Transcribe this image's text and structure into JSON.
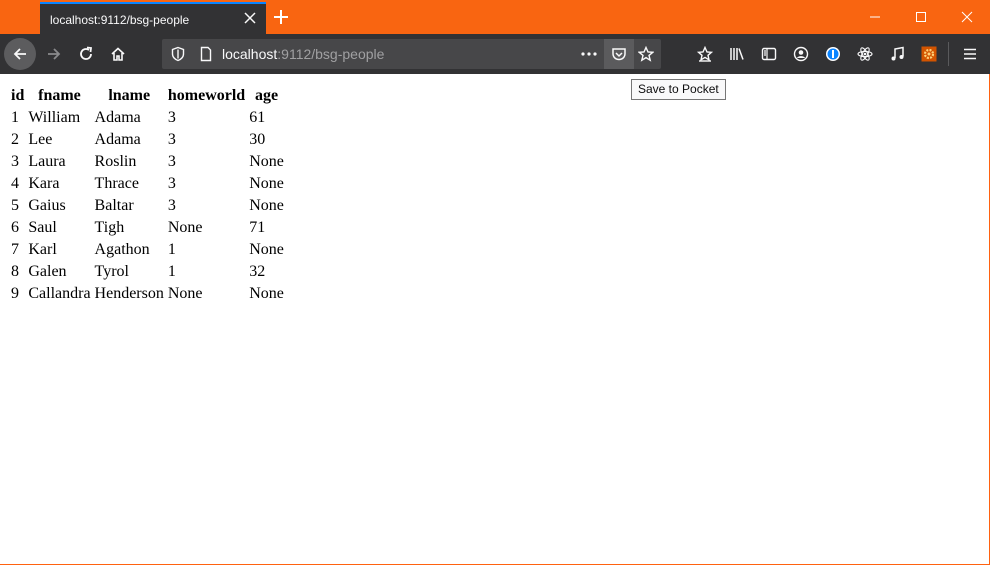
{
  "browser": {
    "tab_title": "localhost:9112/bsg-people",
    "url_host": "localhost",
    "url_path": ":9112/bsg-people",
    "tooltip": "Save to Pocket",
    "accent_color": "#0a84ff",
    "frame_color": "#f96511"
  },
  "table": {
    "headers": [
      "id",
      "fname",
      "lname",
      "homeworld",
      "age"
    ],
    "rows": [
      [
        "1",
        "William",
        "Adama",
        "3",
        "61"
      ],
      [
        "2",
        "Lee",
        "Adama",
        "3",
        "30"
      ],
      [
        "3",
        "Laura",
        "Roslin",
        "3",
        "None"
      ],
      [
        "4",
        "Kara",
        "Thrace",
        "3",
        "None"
      ],
      [
        "5",
        "Gaius",
        "Baltar",
        "3",
        "None"
      ],
      [
        "6",
        "Saul",
        "Tigh",
        "None",
        "71"
      ],
      [
        "7",
        "Karl",
        "Agathon",
        "1",
        "None"
      ],
      [
        "8",
        "Galen",
        "Tyrol",
        "1",
        "32"
      ],
      [
        "9",
        "Callandra",
        "Henderson",
        "None",
        "None"
      ]
    ]
  }
}
